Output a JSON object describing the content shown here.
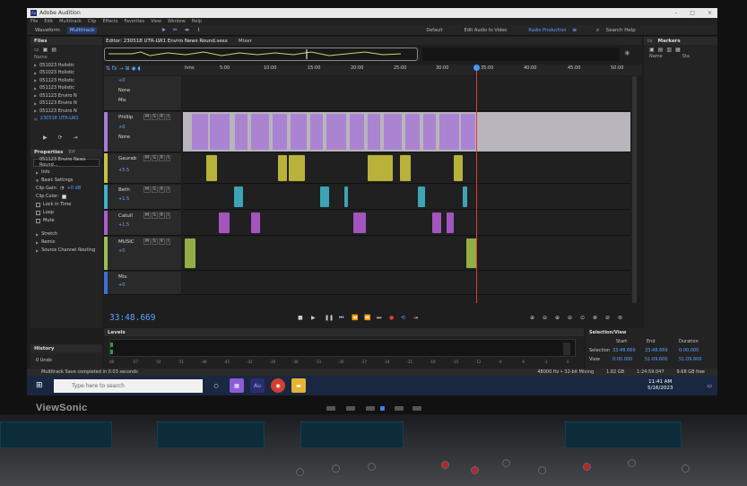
{
  "window": {
    "title": "Adobe Audition",
    "controls": [
      "–",
      "□",
      "×"
    ]
  },
  "menu": [
    "File",
    "Edit",
    "Multitrack",
    "Clip",
    "Effects",
    "Favorites",
    "View",
    "Window",
    "Help"
  ],
  "toolbar": {
    "views": [
      "Waveform",
      "Multitrack"
    ],
    "workspaces": [
      "Default",
      "Edit Audio to Video",
      "Radio Production"
    ],
    "search": "Search Help"
  },
  "files_panel": {
    "title": "Files",
    "column": "Name",
    "items": [
      "051023 Holistic",
      "051023 Holistic",
      "051123 Holistic",
      "051123 Holistic",
      "051123 Enviro N",
      "051123 Enviro N",
      "051123 Enviro N",
      "230518 UTR-LW1"
    ]
  },
  "properties_panel": {
    "tabs": [
      "Properties",
      "Eff"
    ],
    "file": "051123 Enviro News Round...",
    "sections": [
      "Info",
      "Basic Settings"
    ],
    "clip_gain_label": "Clip Gain:",
    "clip_gain_value": "+0 dB",
    "clip_color_label": "Clip Color:",
    "checkboxes": [
      "Lock in Time",
      "Loop",
      "Mute"
    ],
    "more_sections": [
      "Stretch",
      "Remix",
      "Source Channel Routing"
    ]
  },
  "history_panel": {
    "title": "History",
    "undo": "0 Undo"
  },
  "editor": {
    "tab": "Editor: 230518 UTR-LW1 Enviro News Round.sesx",
    "mixer_tab": "Mixer",
    "ruler": [
      "hms",
      "5:00",
      "10:00",
      "15:00",
      "20:00",
      "25:00",
      "30:00",
      "35:00",
      "40:00",
      "45:00",
      "50:00"
    ],
    "master_routing": [
      "None",
      "Mix"
    ],
    "tracks": [
      {
        "name": "Phillip",
        "volume": "+0",
        "routing": "None",
        "color": "#a77bd6"
      },
      {
        "name": "Gaurab",
        "volume": "+5.5",
        "color": "#c9c23e"
      },
      {
        "name": "Beth",
        "volume": "+1.5",
        "color": "#3fb3c4"
      },
      {
        "name": "Catull",
        "volume": "+1.5",
        "color": "#b25ad0"
      },
      {
        "name": "MUSIC",
        "volume": "+0",
        "color": "#9fbf4a"
      },
      {
        "name": "Mix",
        "volume": "+0",
        "color": "#3f6fd6"
      }
    ],
    "msr": [
      "M",
      "S",
      "R",
      "I"
    ],
    "master_volume": "+0",
    "timecode": "33:48.669"
  },
  "right_panel": {
    "tabs": [
      "ta",
      "Markers"
    ],
    "columns": [
      "Name",
      "Sta"
    ]
  },
  "levels": {
    "title": "Levels",
    "scale": [
      "dB",
      "-57",
      "-54",
      "-51",
      "-48",
      "-45",
      "-42",
      "-39",
      "-36",
      "-33",
      "-30",
      "-27",
      "-24",
      "-21",
      "-18",
      "-15",
      "-12",
      "-9",
      "-6",
      "-3",
      "0"
    ]
  },
  "selection_view": {
    "title": "Selection/View",
    "headers": [
      "Start",
      "End",
      "Duration"
    ],
    "selection_label": "Selection",
    "view_label": "View",
    "selection": [
      "33:48.669",
      "33:48.669",
      "0:00.000"
    ],
    "view": [
      "0:00.000",
      "51:09.600",
      "51:09.600"
    ]
  },
  "status": {
    "message": "Multitrack Save completed in 0.03 seconds",
    "format": "48000 Hz • 32-bit Mixing",
    "size": "1.82 GB",
    "duration": "1:24:59.047",
    "free": "9.68 GB free"
  },
  "taskbar": {
    "search": "Type here to search",
    "time": "11:41 AM",
    "date": "5/16/2023",
    "apps": [
      "Au"
    ]
  },
  "monitor": {
    "brand": "ViewSonic"
  }
}
